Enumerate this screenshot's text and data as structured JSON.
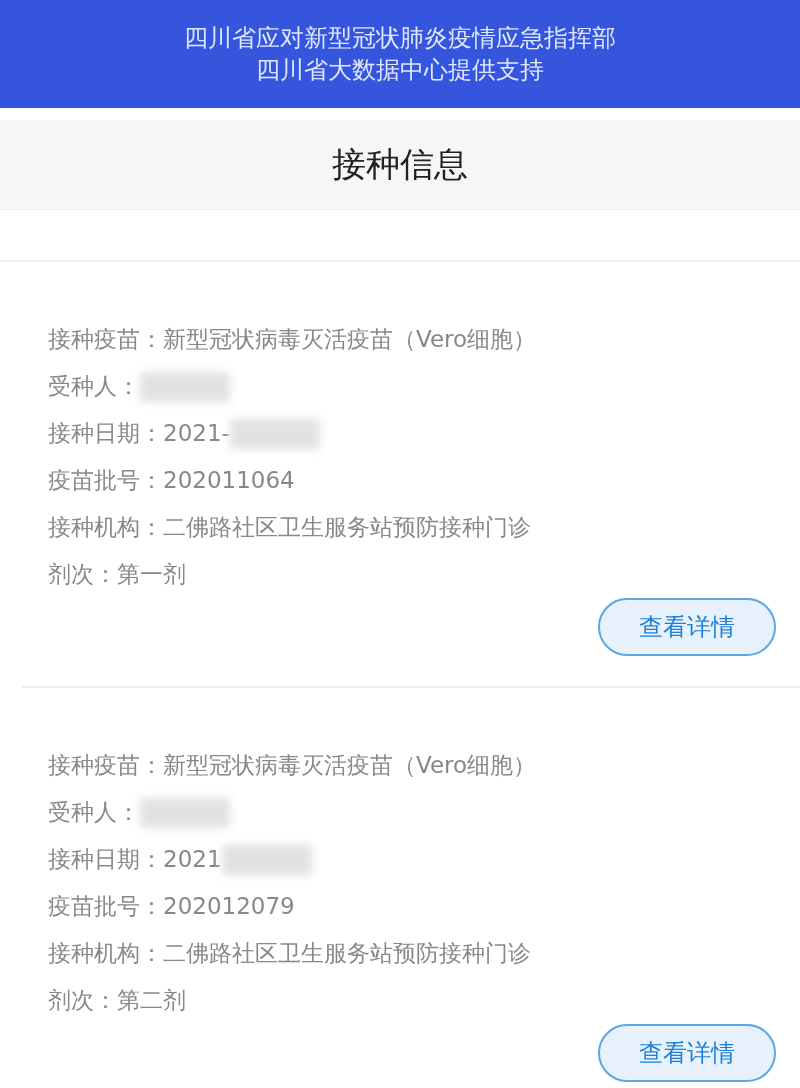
{
  "banner": {
    "lines": [
      "四川省应对新型冠状肺炎疫情应急指挥部",
      "四川省大数据中心提供支持"
    ]
  },
  "header": {
    "title": "接种信息"
  },
  "records": [
    {
      "fields": [
        {
          "label": "接种疫苗：",
          "value": "新型冠状病毒灭活疫苗（Vero细胞）",
          "redacted": false
        },
        {
          "label": "受种人：",
          "redacted": true
        },
        {
          "label": "接种日期：",
          "value": "2021-",
          "redacted": true
        },
        {
          "label": "疫苗批号：",
          "value": "202011064",
          "redacted": false
        },
        {
          "label": "接种机构：",
          "value": "二佛路社区卫生服务站预防接种门诊",
          "redacted": false
        },
        {
          "label": "剂次：",
          "value": "第一剂",
          "redacted": false
        }
      ],
      "button": "查看详情"
    },
    {
      "fields": [
        {
          "label": "接种疫苗：",
          "value": "新型冠状病毒灭活疫苗（Vero细胞）",
          "redacted": false
        },
        {
          "label": "受种人：",
          "redacted": true
        },
        {
          "label": "接种日期：",
          "value": "2021",
          "redacted": true
        },
        {
          "label": "疫苗批号：",
          "value": "202012079",
          "redacted": false
        },
        {
          "label": "接种机构：",
          "value": "二佛路社区卫生服务站预防接种门诊",
          "redacted": false
        },
        {
          "label": "剂次：",
          "value": "第二剂",
          "redacted": false
        }
      ],
      "button": "查看详情"
    }
  ]
}
